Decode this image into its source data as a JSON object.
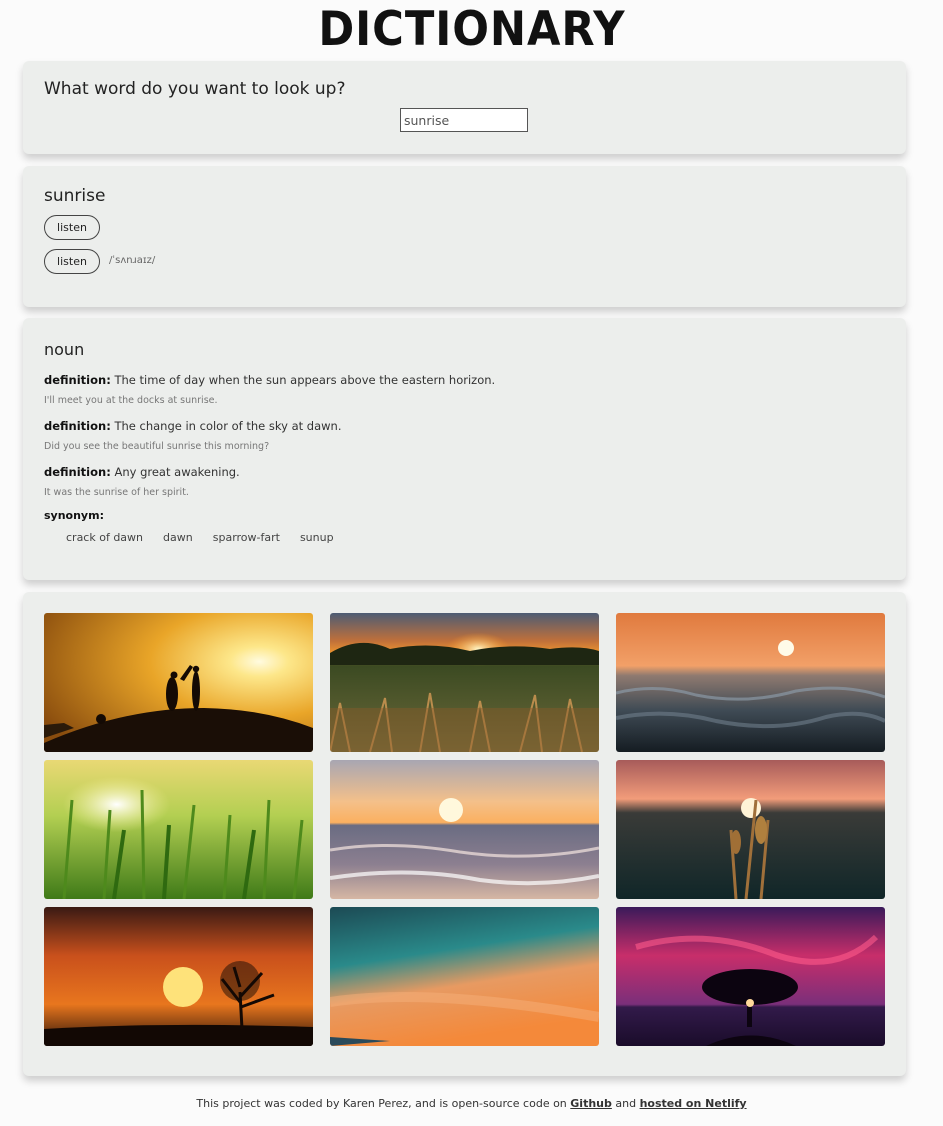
{
  "header": {
    "logo_text": "DICTIONARY"
  },
  "search": {
    "title": "What word do you want to look up?",
    "value": "sunrise"
  },
  "word": {
    "title": "sunrise",
    "listen_label_1": "listen",
    "listen_label_2": "listen",
    "phonetic": "/ˈsʌnɹaɪz/"
  },
  "meaning": {
    "part_of_speech": "noun",
    "definition_label": "definition:",
    "definitions": [
      {
        "text": "The time of day when the sun appears above the eastern horizon.",
        "example": "I'll meet you at the docks at sunrise."
      },
      {
        "text": "The change in color of the sky at dawn.",
        "example": "Did you see the beautiful sunrise this morning?"
      },
      {
        "text": "Any great awakening.",
        "example": "It was the sunrise of her spirit."
      }
    ],
    "synonym_label": "synonym:",
    "synonyms": [
      "crack of dawn",
      "dawn",
      "sparrow-fart",
      "sunup"
    ]
  },
  "photos": [
    {
      "name": "couple-silhouette-sunset-photo"
    },
    {
      "name": "grass-field-sunrise-photo"
    },
    {
      "name": "ocean-waves-sun-photo"
    },
    {
      "name": "wheat-field-sun-photo"
    },
    {
      "name": "beach-sunrise-photo"
    },
    {
      "name": "wheat-silhouette-sunset-photo"
    },
    {
      "name": "tree-orange-sunset-photo"
    },
    {
      "name": "teal-orange-sky-photo"
    },
    {
      "name": "tree-pink-sky-photo"
    }
  ],
  "footer": {
    "text": "This project was coded by Karen Perez, and is open-source code on",
    "github_label": "Github",
    "and_text": "and",
    "netlify_label": "hosted on Netlify"
  }
}
